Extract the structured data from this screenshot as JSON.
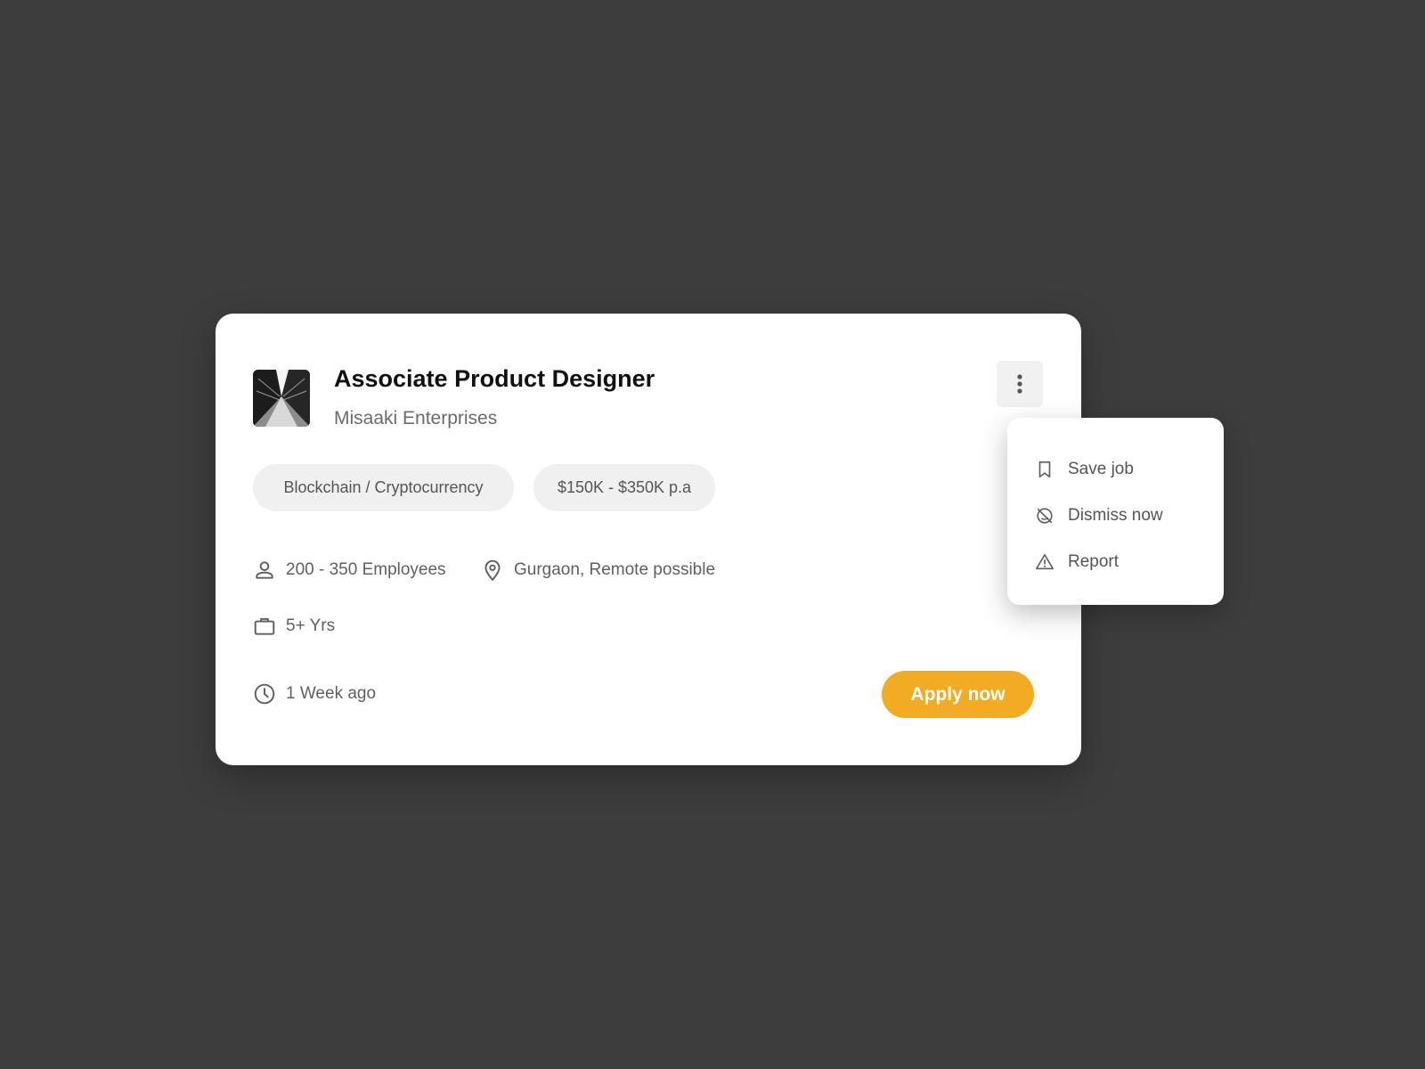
{
  "job": {
    "title": "Associate Product Designer",
    "company": "Misaaki Enterprises",
    "logo_icon": "building-skyline-logo",
    "tags": [
      "Blockchain / Cryptocurrency",
      "$150K - $350K p.a"
    ],
    "employees": "200 - 350 Employees",
    "location": "Gurgaon, Remote possible",
    "experience": "5+ Yrs",
    "posted": "1 Week ago",
    "apply_label": "Apply now",
    "more_icon": "more-vertical-icon"
  },
  "menu": {
    "items": [
      {
        "label": "Save job",
        "icon": "bookmark-icon"
      },
      {
        "label": "Dismiss now",
        "icon": "dismiss-icon"
      },
      {
        "label": "Report",
        "icon": "warning-icon"
      }
    ]
  },
  "colors": {
    "background": "#3d3d3d",
    "card": "#ffffff",
    "accent": "#f2ab22",
    "tag_bg": "#f0f0f1",
    "text_primary": "#111111",
    "text_secondary": "#6b6b6b"
  }
}
